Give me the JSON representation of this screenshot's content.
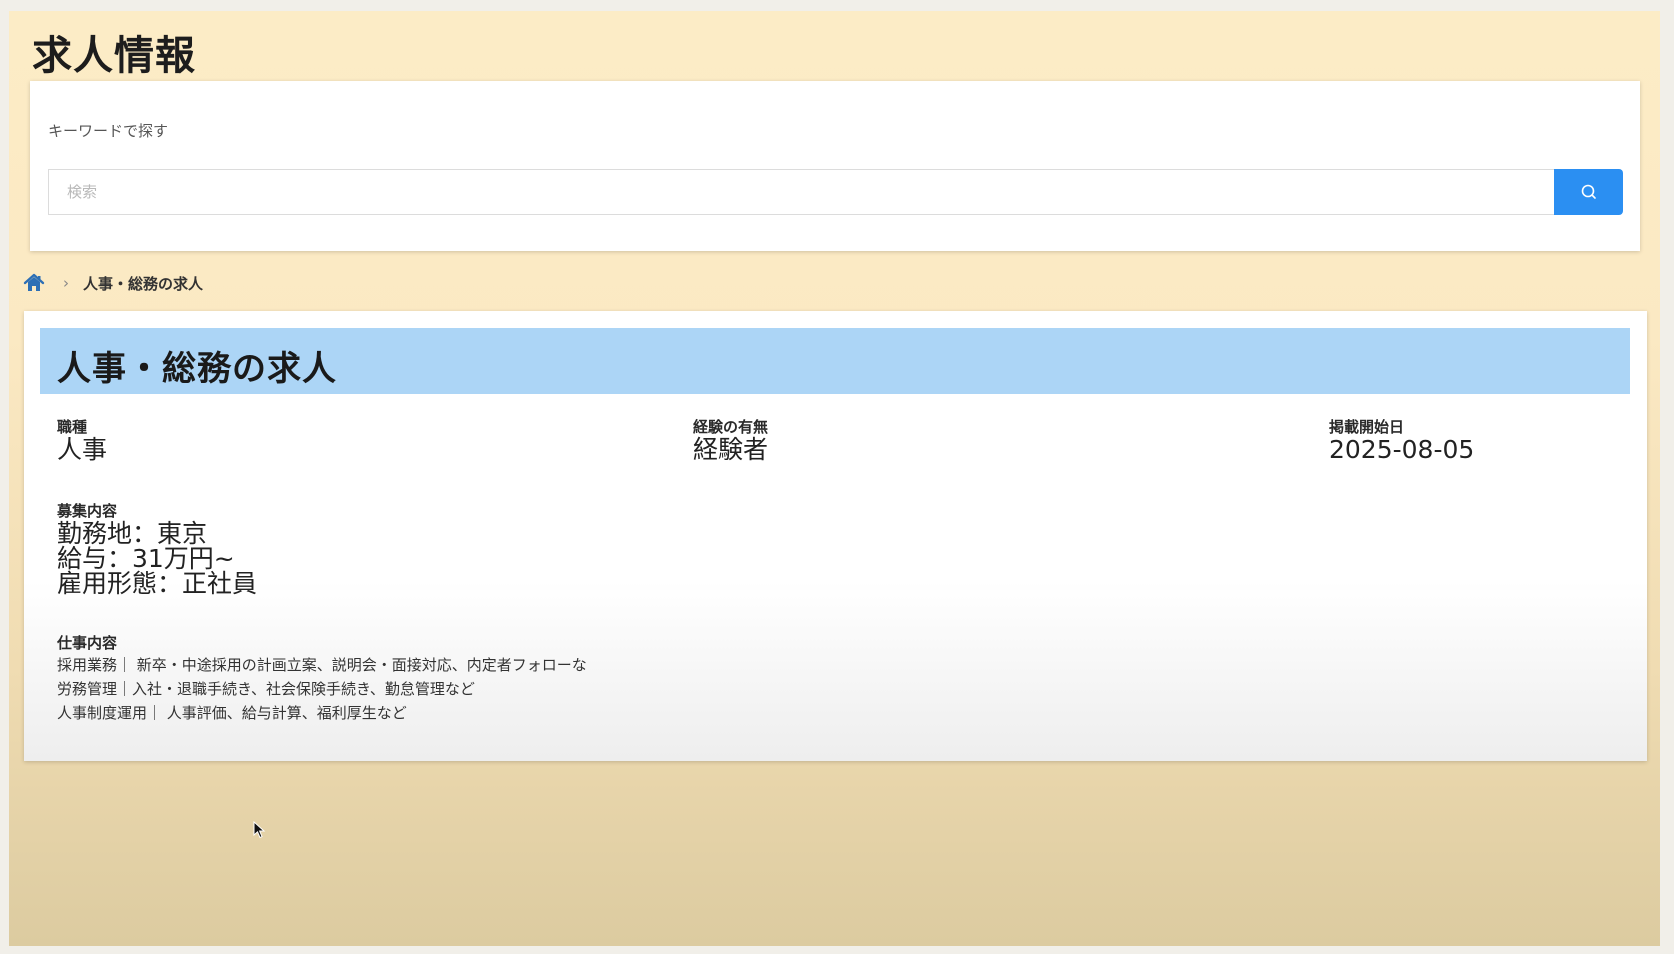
{
  "header": {
    "title": "求人情報"
  },
  "search": {
    "label": "キーワードで探す",
    "placeholder": "検索",
    "value": "",
    "button_icon": "search-icon",
    "accent_color": "#2b8ff2"
  },
  "breadcrumb": {
    "home_icon": "home-icon",
    "separator": "›",
    "current": "人事・総務の求人"
  },
  "job": {
    "title": "人事・総務の求人",
    "header_color": "#acd5f6",
    "occupation": {
      "label": "職種",
      "value": "人事"
    },
    "experience": {
      "label": "経験の有無",
      "value": "経験者"
    },
    "posted": {
      "label": "掲載開始日",
      "value": "2025-08-05"
    },
    "recruitment": {
      "label": "募集内容",
      "lines": [
        "勤務地：東京",
        "給与：31万円~",
        "雇用形態：正社員"
      ]
    },
    "duties": {
      "label": "仕事内容",
      "lines": [
        "採用業務｜ 新卒・中途採用の計画立案、説明会・面接対応、内定者フォローな",
        "労務管理｜入社・退職手続き、社会保険手続き、勤怠管理など",
        "人事制度運用｜ 人事評価、給与計算、福利厚生など"
      ]
    }
  }
}
